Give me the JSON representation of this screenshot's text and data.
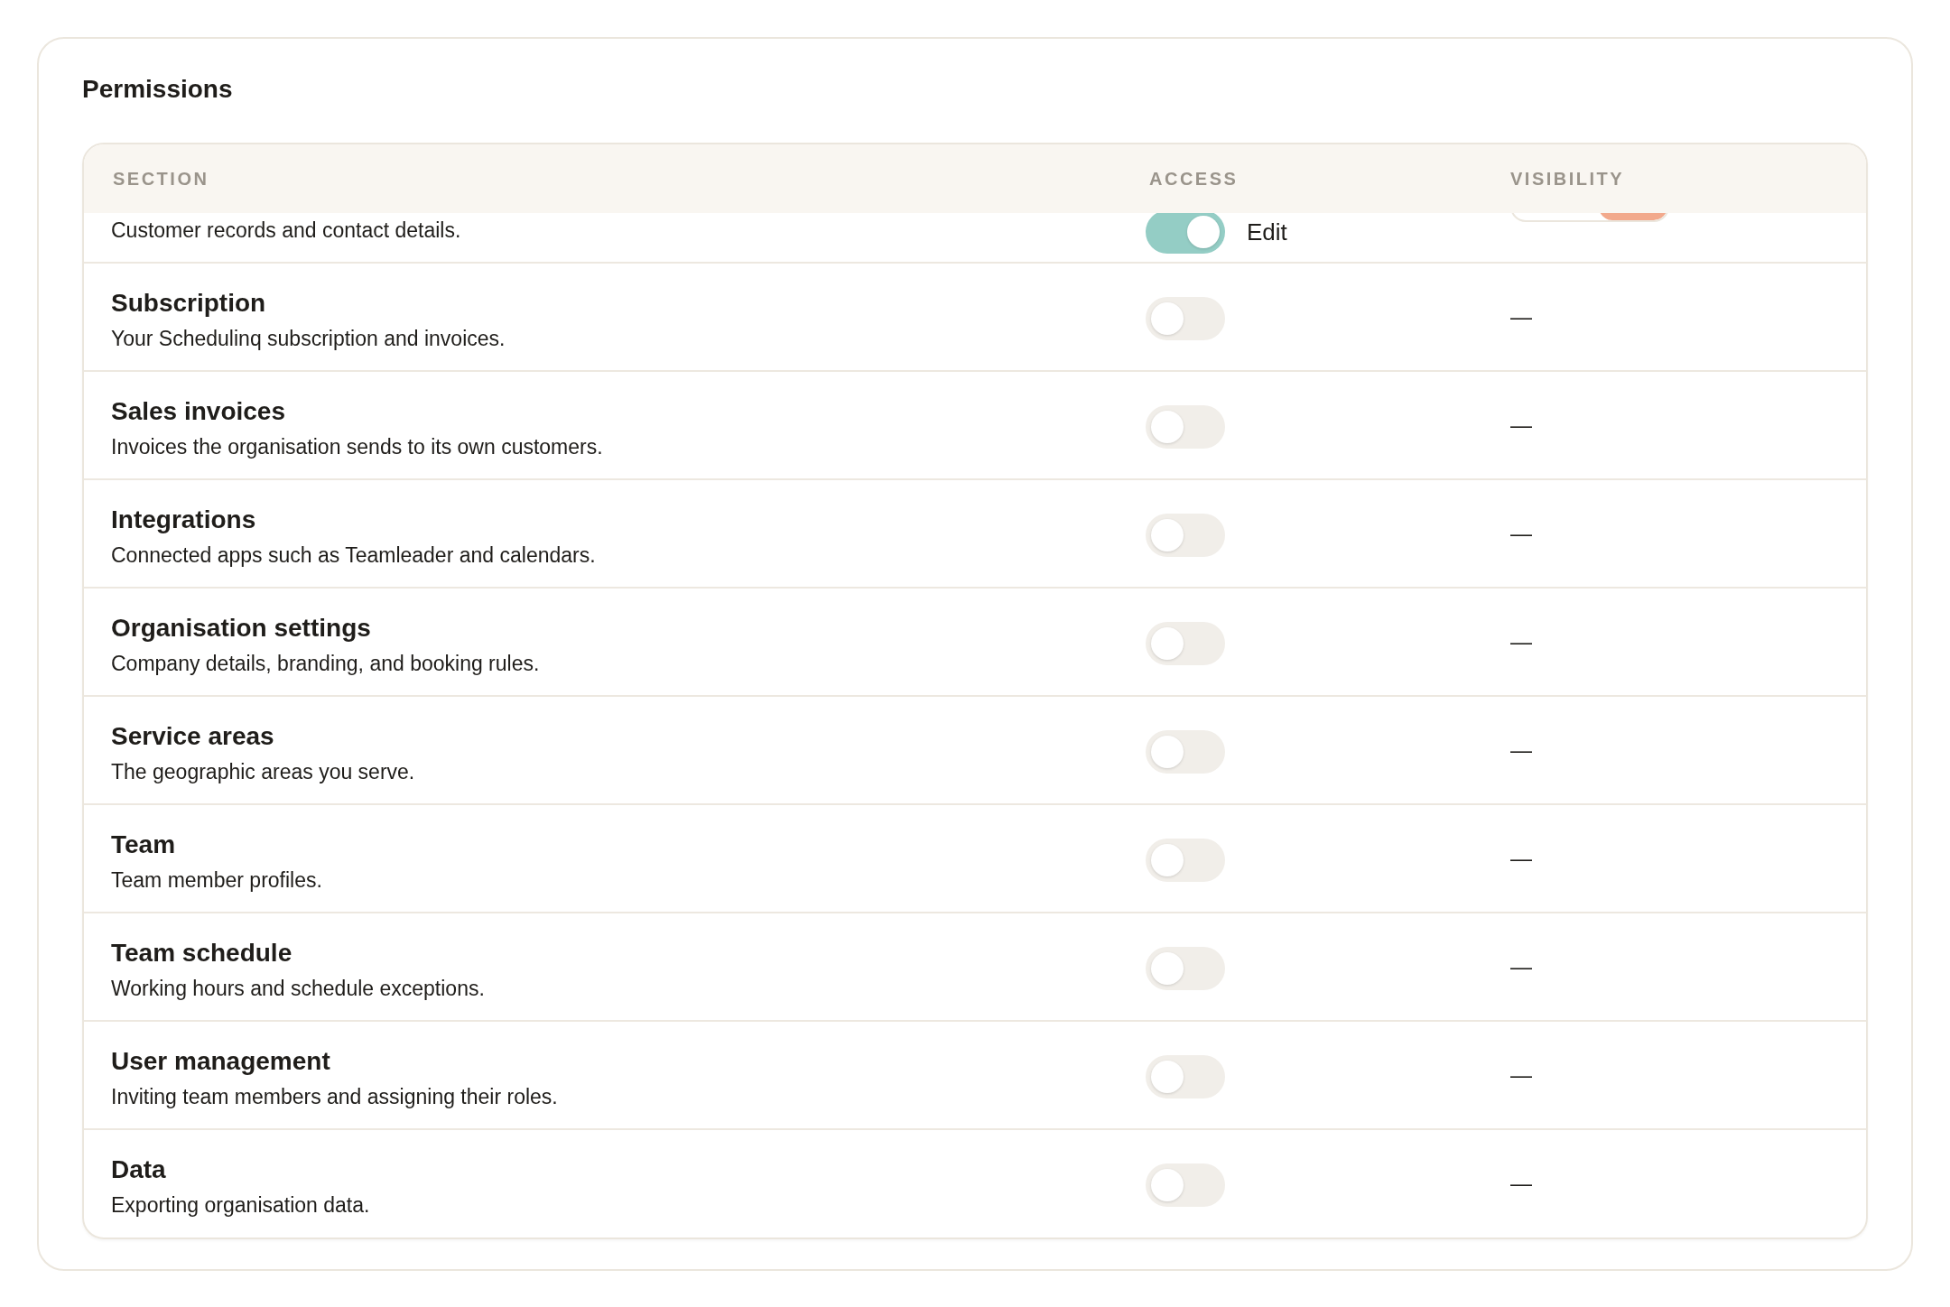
{
  "card": {
    "title": "Permissions"
  },
  "table": {
    "columns": [
      "SECTION",
      "ACCESS",
      "VISIBILITY"
    ],
    "rows": [
      {
        "description": "Customer records and contact details.",
        "access": {
          "on": true,
          "label": "Edit"
        },
        "visibility": {
          "kind": "segmented"
        }
      },
      {
        "title": "Subscription",
        "description": "Your Schedulinq subscription and invoices.",
        "access": {
          "on": false
        },
        "visibility": {
          "kind": "text",
          "text": "—"
        }
      },
      {
        "title": "Sales invoices",
        "description": "Invoices the organisation sends to its own customers.",
        "access": {
          "on": false
        },
        "visibility": {
          "kind": "text",
          "text": "—"
        }
      },
      {
        "title": "Integrations",
        "description": "Connected apps such as Teamleader and calendars.",
        "access": {
          "on": false
        },
        "visibility": {
          "kind": "text",
          "text": "—"
        }
      },
      {
        "title": "Organisation settings",
        "description": "Company details, branding, and booking rules.",
        "access": {
          "on": false
        },
        "visibility": {
          "kind": "text",
          "text": "—"
        }
      },
      {
        "title": "Service areas",
        "description": "The geographic areas you serve.",
        "access": {
          "on": false
        },
        "visibility": {
          "kind": "text",
          "text": "—"
        }
      },
      {
        "title": "Team",
        "description": "Team member profiles.",
        "access": {
          "on": false
        },
        "visibility": {
          "kind": "text",
          "text": "—"
        }
      },
      {
        "title": "Team schedule",
        "description": "Working hours and schedule exceptions.",
        "access": {
          "on": false
        },
        "visibility": {
          "kind": "text",
          "text": "—"
        }
      },
      {
        "title": "User management",
        "description": "Inviting team members and assigning their roles.",
        "access": {
          "on": false
        },
        "visibility": {
          "kind": "text",
          "text": "—"
        }
      },
      {
        "title": "Data",
        "description": "Exporting organisation data.",
        "access": {
          "on": false
        },
        "visibility": {
          "kind": "text",
          "text": "—"
        }
      }
    ]
  }
}
